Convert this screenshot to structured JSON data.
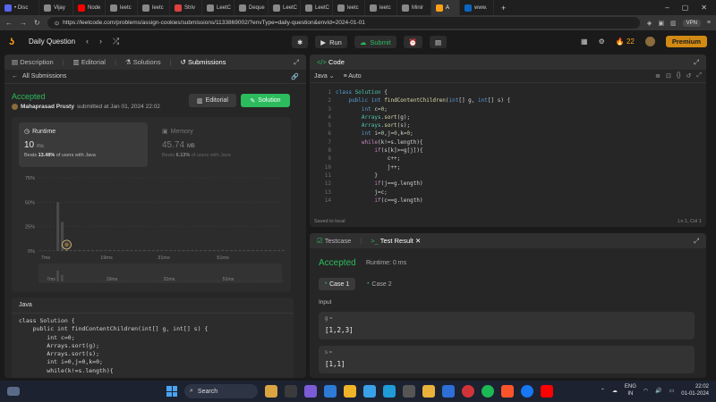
{
  "browser": {
    "tabs": [
      {
        "label": "• Disc",
        "color": "#5865f2"
      },
      {
        "label": "Vijay",
        "color": "#888888"
      },
      {
        "label": "Node",
        "color": "#ff0000"
      },
      {
        "label": "leetc",
        "color": "#888888"
      },
      {
        "label": "leetc",
        "color": "#888888"
      },
      {
        "label": "Striv",
        "color": "#e04040"
      },
      {
        "label": "LeetC",
        "color": "#888888"
      },
      {
        "label": "Deque",
        "color": "#888888"
      },
      {
        "label": "LeetC",
        "color": "#888888"
      },
      {
        "label": "LeetC",
        "color": "#888888"
      },
      {
        "label": "leetc",
        "color": "#888888"
      },
      {
        "label": "leetc",
        "color": "#888888"
      },
      {
        "label": "Minir",
        "color": "#888888"
      },
      {
        "label": "A",
        "color": "#ffa116",
        "active": true
      },
      {
        "label": "www.",
        "color": "#0a66c2"
      }
    ],
    "url": "https://leetcode.com/problems/assign-cookies/submissions/1133869002/?envType=daily-question&envId=2024-01-01",
    "vpn_label": "VPN"
  },
  "header": {
    "title": "Daily Question",
    "run_label": "Run",
    "submit_label": "Submit",
    "streak": "22",
    "premium_label": "Premium"
  },
  "left": {
    "tabs": [
      "Description",
      "Editorial",
      "Solutions",
      "Submissions"
    ],
    "all_submissions": "All Submissions",
    "status": "Accepted",
    "author": "Mahaprasad Prusty",
    "submitted": "submitted at Jan 01, 2024 22:02",
    "editorial_btn": "Editorial",
    "solution_btn": "Solution",
    "runtime": {
      "label": "Runtime",
      "value": "10",
      "unit": "ms",
      "beats_pre": "Beats",
      "beats_val": "13.48%",
      "beats_post": "of users with Java"
    },
    "memory": {
      "label": "Memory",
      "value": "45.74",
      "unit": "MB",
      "beats_pre": "Beats",
      "beats_val": "6.13%",
      "beats_post": "of users with Java"
    },
    "language": "Java"
  },
  "chart_data": {
    "type": "bar",
    "ylabel": "",
    "xlabel": "",
    "yticks": [
      "75%",
      "50%",
      "25%",
      "0%"
    ],
    "ylim": [
      0,
      75
    ],
    "x_tick_labels": [
      "7ms",
      "19ms",
      "31ms",
      "51ms"
    ],
    "mini_tick_labels": [
      "7ms",
      "19ms",
      "31ms",
      "51ms"
    ],
    "values": [
      0,
      0,
      0,
      0,
      50,
      30,
      1,
      1,
      1,
      1,
      1,
      1,
      1,
      1,
      1,
      1,
      1,
      1,
      1,
      1,
      1,
      1,
      1,
      1,
      1,
      1,
      1,
      1,
      1,
      1,
      1,
      1,
      1,
      1,
      1,
      1,
      1,
      1,
      1,
      1,
      1,
      1,
      1,
      1,
      1,
      1,
      1,
      1,
      1,
      1,
      1,
      1,
      1,
      1,
      1,
      1,
      1
    ],
    "highlight_index": 6,
    "grid": true
  },
  "code": {
    "tab_label": "Code",
    "language": "Java",
    "mode": "Auto",
    "saved": "Saved to local",
    "cursor": "Ln 1, Col 1",
    "line_numbers": [
      "1",
      "2",
      "3",
      "4",
      "5",
      "6",
      "7",
      "8",
      "9",
      "10",
      "11",
      "12",
      "13",
      "14"
    ]
  },
  "code_small": "class Solution {\n    public int findContentChildren(int[] g, int[] s) {\n        int c=0;\n        Arrays.sort(g);\n        Arrays.sort(s);\n        int i=0,j=0,k=0;\n        while(k!=s.length){",
  "test": {
    "tab_testcase": "Testcase",
    "tab_result": "Test Result",
    "status": "Accepted",
    "runtime": "Runtime: 0 ms",
    "case1": "Case 1",
    "case2": "Case 2",
    "input_label": "Input",
    "g_name": "g =",
    "g_value": "[1,2,3]",
    "s_name": "s =",
    "s_value": "[1,1]"
  },
  "taskbar": {
    "search": "Search",
    "lang": "ENG",
    "region": "IN",
    "time": "22:02",
    "date": "01-01-2024"
  },
  "colors": {
    "accent": "#ffa116",
    "success": "#2cbb5d"
  }
}
